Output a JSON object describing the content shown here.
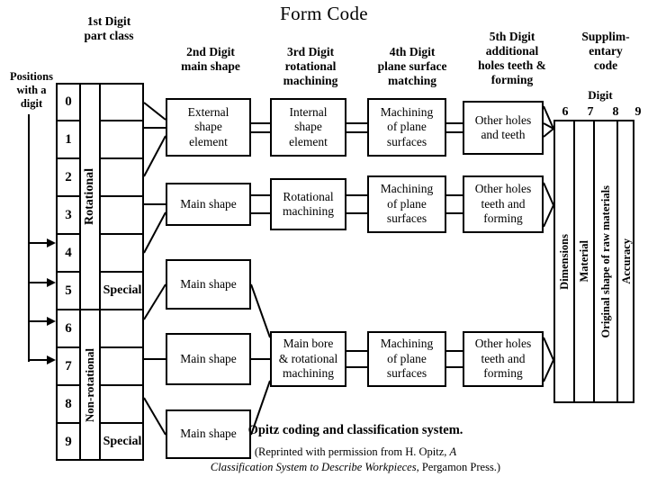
{
  "title": "Form Code",
  "headers": {
    "positions": "Positions\nwith a\ndigit",
    "first_digit": "1st Digit\npart class",
    "second_digit": "2nd Digit\nmain shape",
    "third_digit": "3rd Digit\nrotational\nmachining",
    "fourth_digit": "4th Digit\nplane surface\nmatching",
    "fifth_digit": "5th Digit\nadditional\nholes teeth &\nforming",
    "supplementary": "Supplim-\nentary\ncode",
    "digit_word": "Digit"
  },
  "first_digit_table": {
    "rows": [
      "0",
      "1",
      "2",
      "3",
      "4",
      "5",
      "6",
      "7",
      "8",
      "9"
    ],
    "group_rotational": "Rotational",
    "group_non_rotational": "Non-rotational",
    "special_upper": "Special",
    "special_lower": "Special",
    "arrow_rows": [
      "4",
      "5",
      "6",
      "7"
    ]
  },
  "boxes": {
    "external_shape_element": "External\nshape\nelement",
    "internal_shape_element": "Internal\nshape\nelement",
    "machining_of_plane_surfaces_1": "Machining\nof plane\nsurfaces",
    "other_holes_and_teeth": "Other holes\nand teeth",
    "main_shape_1": "Main shape",
    "rotational_machining": "Rotational\nmachining",
    "machining_of_plane_surfaces_2": "Machining\nof plane\nsurfaces",
    "other_holes_teeth_and_forming_1": "Other holes\nteeth and\nforming",
    "main_shape_2": "Main shape",
    "main_shape_3": "Main shape",
    "main_shape_4": "Main shape",
    "main_bore_rotational_machining": "Main bore\n& rotational\nmachining",
    "machining_of_plane_surfaces_3": "Machining\nof plane\nsurfaces",
    "other_holes_teeth_and_forming_2": "Other holes\nteeth and\nforming"
  },
  "supplementary_code": {
    "digits": [
      "6",
      "7",
      "8",
      "9"
    ],
    "columns": [
      "Dimensions",
      "Material",
      "Original shape of raw materials",
      "Accuracy"
    ]
  },
  "caption": {
    "main": "Opitz coding and classification system.",
    "line1_pre": "(Reprinted with permission from H. Opitz, ",
    "line1_italic": "A",
    "line2_italic": "Classification System to Describe Workpieces",
    "line2_post": ", Pergamon Press.)"
  },
  "colors": {
    "ink": "#000000",
    "paper": "#ffffff"
  }
}
